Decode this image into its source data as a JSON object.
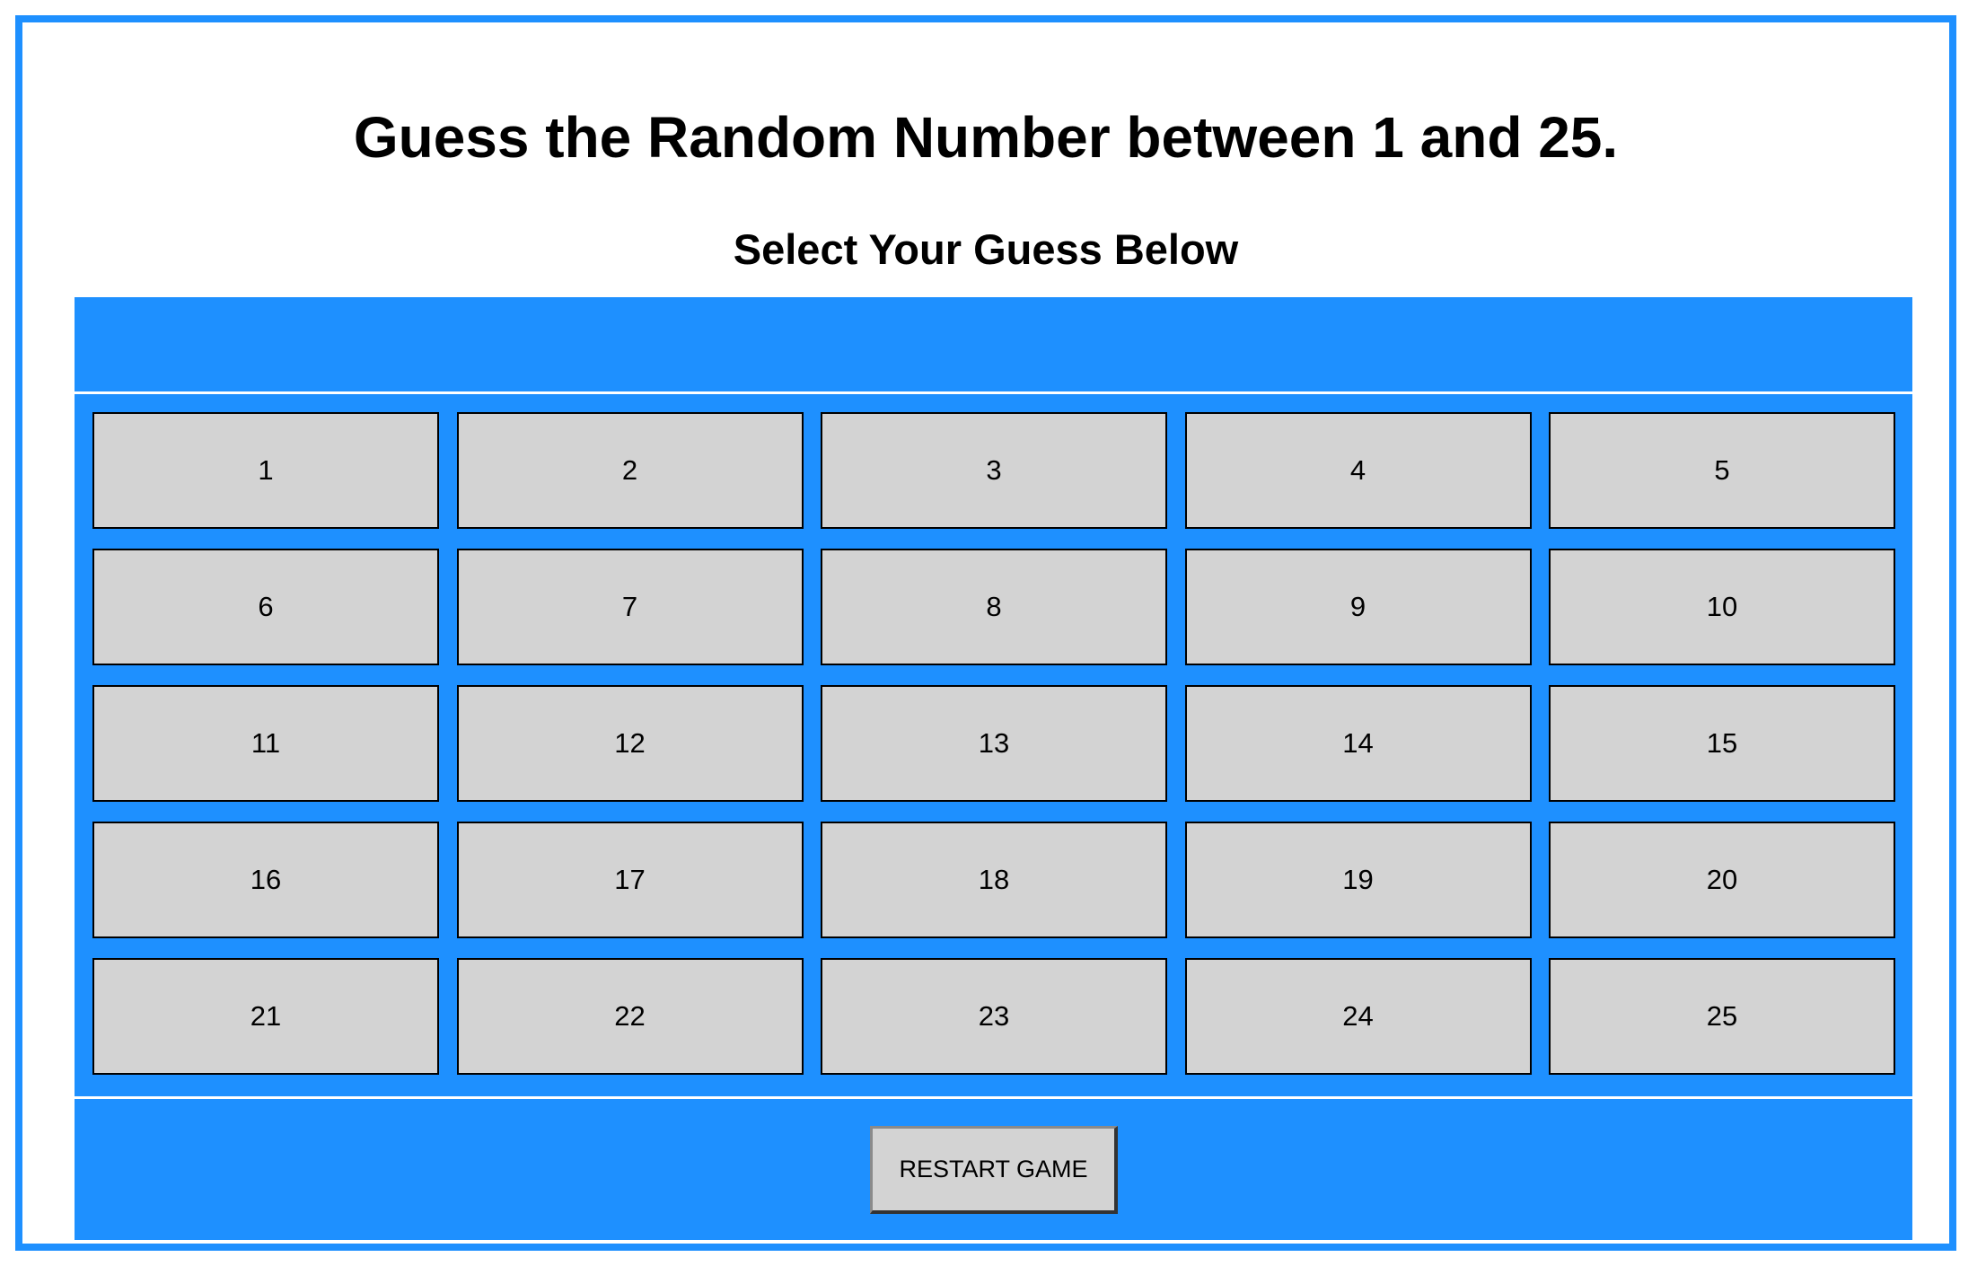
{
  "page": {
    "title": "Guess the Random Number between 1 and 25.",
    "subtitle": "Select Your Guess Below",
    "message": ""
  },
  "grid": {
    "numbers": [
      "1",
      "2",
      "3",
      "4",
      "5",
      "6",
      "7",
      "8",
      "9",
      "10",
      "11",
      "12",
      "13",
      "14",
      "15",
      "16",
      "17",
      "18",
      "19",
      "20",
      "21",
      "22",
      "23",
      "24",
      "25"
    ]
  },
  "footer": {
    "restart_label": "RESTART GAME"
  },
  "colors": {
    "accent": "#1e90ff",
    "button_bg": "#d3d3d3",
    "page_bg": "#ffffff"
  }
}
